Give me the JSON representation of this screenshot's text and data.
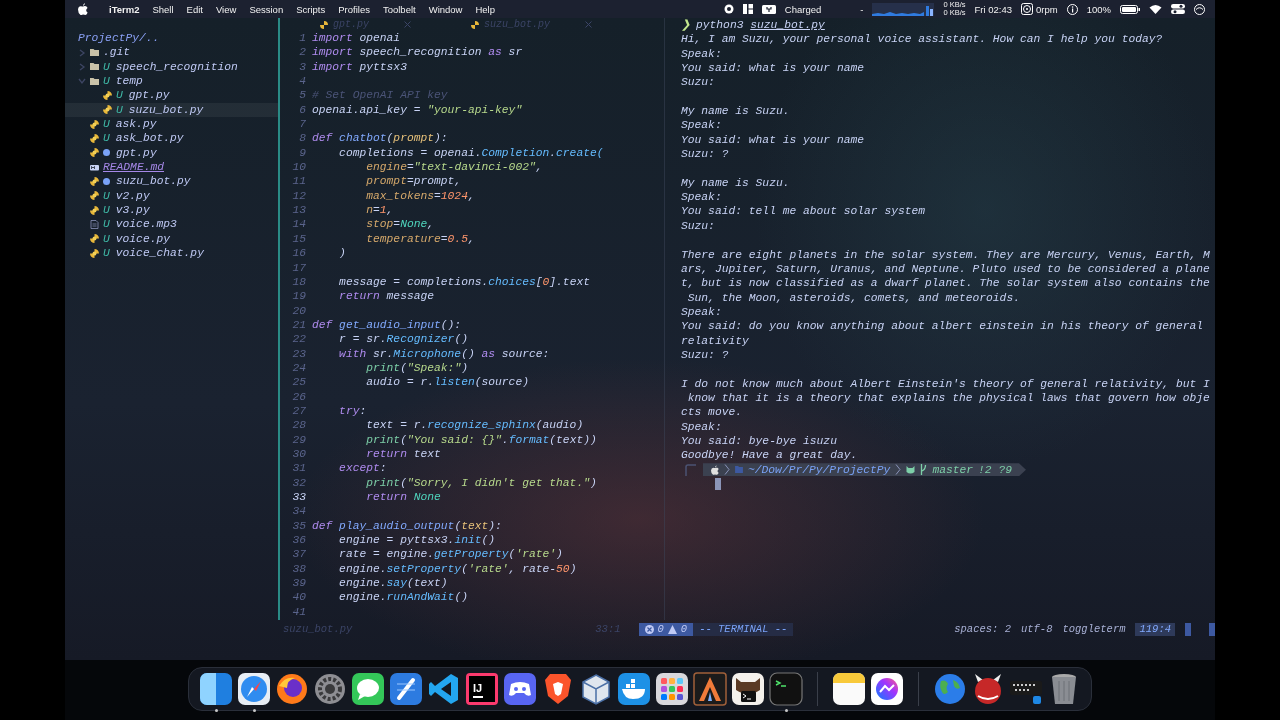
{
  "menu_bar": {
    "app": "iTerm2",
    "menus": [
      "Shell",
      "Edit",
      "View",
      "Session",
      "Scripts",
      "Profiles",
      "Toolbelt",
      "Window",
      "Help"
    ],
    "power_status": "Charged",
    "dash": "-",
    "net_up": "0 KB/s",
    "net_down": "0 KB/s",
    "clock": "Fri 02:43",
    "fan": "0rpm",
    "battery": "100%"
  },
  "sidebar": {
    "title": "ProjectPy/..",
    "items": [
      {
        "name": ".git",
        "kind": "folder",
        "expanded": false,
        "selected": false,
        "modified": false
      },
      {
        "name": "speech_recognition",
        "kind": "folder",
        "git": "U",
        "expanded": false,
        "selected": false,
        "modified": false
      },
      {
        "name": "temp",
        "kind": "folder",
        "git": "U",
        "expanded": true,
        "selected": false,
        "modified": false,
        "children": [
          {
            "name": "gpt.py",
            "kind": "python",
            "git": "U",
            "selected": false,
            "modified": false
          },
          {
            "name": "suzu_bot.py",
            "kind": "python",
            "git": "U",
            "selected": true,
            "modified": false
          }
        ]
      },
      {
        "name": "ask.py",
        "kind": "python",
        "git": "U",
        "selected": false,
        "modified": false
      },
      {
        "name": "ask_bot.py",
        "kind": "python",
        "git": "U",
        "selected": false,
        "modified": false
      },
      {
        "name": "gpt.py",
        "kind": "python",
        "selected": false,
        "modified": true
      },
      {
        "name": "README.md",
        "kind": "markdown",
        "selected": false,
        "modified": false
      },
      {
        "name": "suzu_bot.py",
        "kind": "python",
        "selected": false,
        "modified": true
      },
      {
        "name": "v2.py",
        "kind": "python",
        "git": "U",
        "selected": false,
        "modified": false
      },
      {
        "name": "v3.py",
        "kind": "python",
        "git": "U",
        "selected": false,
        "modified": false
      },
      {
        "name": "voice.mp3",
        "kind": "file",
        "git": "U",
        "selected": false,
        "modified": false
      },
      {
        "name": "voice.py",
        "kind": "python",
        "git": "U",
        "selected": false,
        "modified": false
      },
      {
        "name": "voice_chat.py",
        "kind": "python",
        "git": "U",
        "selected": false,
        "modified": false
      }
    ]
  },
  "editor": {
    "tabs": [
      {
        "label": "gpt.py",
        "selected": false
      },
      {
        "label": "suzu_bot.py",
        "selected": false
      }
    ],
    "lines": [
      {
        "number": "1",
        "current": false,
        "tokens": [
          {
            "kind": "kw",
            "text": "import"
          },
          {
            "kind": "p",
            "text": " openai"
          }
        ]
      },
      {
        "number": "2",
        "current": false,
        "tokens": [
          {
            "kind": "kw",
            "text": "import"
          },
          {
            "kind": "p",
            "text": " speech_recognition "
          },
          {
            "kind": "kw",
            "text": "as"
          },
          {
            "kind": "p",
            "text": " sr"
          }
        ]
      },
      {
        "number": "3",
        "current": false,
        "tokens": [
          {
            "kind": "kw",
            "text": "import"
          },
          {
            "kind": "p",
            "text": " pyttsx3"
          }
        ]
      },
      {
        "number": "4",
        "current": false
      },
      {
        "number": "5",
        "current": false,
        "tokens": [
          {
            "kind": "cm",
            "text": "# Set OpenAI API key"
          }
        ]
      },
      {
        "number": "6",
        "current": false,
        "tokens": [
          {
            "kind": "p",
            "text": "openai.api_key = "
          },
          {
            "kind": "str",
            "text": "\"your-api-key\""
          }
        ]
      },
      {
        "number": "7",
        "current": false
      },
      {
        "number": "8",
        "current": false,
        "tokens": [
          {
            "kind": "kw",
            "text": "def"
          },
          {
            "kind": "fn",
            "text": " chatbot"
          },
          {
            "kind": "p",
            "text": "("
          },
          {
            "kind": "param",
            "text": "prompt"
          },
          {
            "kind": "p",
            "text": "):"
          }
        ]
      },
      {
        "number": "9",
        "current": false,
        "tokens": [
          {
            "kind": "p",
            "text": "    completions = openai."
          },
          {
            "kind": "m",
            "text": "Completion"
          },
          {
            "kind": "p",
            "text": "."
          },
          {
            "kind": "m",
            "text": "create("
          }
        ]
      },
      {
        "number": "10",
        "current": false,
        "tokens": [
          {
            "kind": "arg",
            "text": "        engine"
          },
          {
            "kind": "p",
            "text": "="
          },
          {
            "kind": "str",
            "text": "\"text-davinci-002\""
          },
          {
            "kind": "p",
            "text": ","
          }
        ]
      },
      {
        "number": "11",
        "current": false,
        "tokens": [
          {
            "kind": "arg",
            "text": "        prompt"
          },
          {
            "kind": "p",
            "text": "=prompt,"
          }
        ]
      },
      {
        "number": "12",
        "current": false,
        "tokens": [
          {
            "kind": "arg",
            "text": "        max_tokens"
          },
          {
            "kind": "p",
            "text": "="
          },
          {
            "kind": "num",
            "text": "1024"
          },
          {
            "kind": "p",
            "text": ","
          }
        ]
      },
      {
        "number": "13",
        "current": false,
        "tokens": [
          {
            "kind": "arg",
            "text": "        n"
          },
          {
            "kind": "p",
            "text": "="
          },
          {
            "kind": "num",
            "text": "1"
          },
          {
            "kind": "p",
            "text": ","
          }
        ]
      },
      {
        "number": "14",
        "current": false,
        "tokens": [
          {
            "kind": "arg",
            "text": "        stop"
          },
          {
            "kind": "p",
            "text": "="
          },
          {
            "kind": "const",
            "text": "None"
          },
          {
            "kind": "p",
            "text": ","
          }
        ]
      },
      {
        "number": "15",
        "current": false,
        "tokens": [
          {
            "kind": "arg",
            "text": "        temperature"
          },
          {
            "kind": "p",
            "text": "="
          },
          {
            "kind": "num",
            "text": "0.5"
          },
          {
            "kind": "p",
            "text": ","
          }
        ]
      },
      {
        "number": "16",
        "current": false,
        "tokens": [
          {
            "kind": "p",
            "text": "    )"
          }
        ]
      },
      {
        "number": "17",
        "current": false
      },
      {
        "number": "18",
        "current": false,
        "tokens": [
          {
            "kind": "p",
            "text": "    message = completions."
          },
          {
            "kind": "m",
            "text": "choices"
          },
          {
            "kind": "p",
            "text": "["
          },
          {
            "kind": "num",
            "text": "0"
          },
          {
            "kind": "p",
            "text": "].text"
          }
        ]
      },
      {
        "number": "19",
        "current": false,
        "tokens": [
          {
            "kind": "kw",
            "text": "    return"
          },
          {
            "kind": "p",
            "text": " message"
          }
        ]
      },
      {
        "number": "20",
        "current": false
      },
      {
        "number": "21",
        "current": false,
        "tokens": [
          {
            "kind": "kw",
            "text": "def"
          },
          {
            "kind": "fn",
            "text": " get_audio_input"
          },
          {
            "kind": "p",
            "text": "():"
          }
        ]
      },
      {
        "number": "22",
        "current": false,
        "tokens": [
          {
            "kind": "p",
            "text": "    r = sr."
          },
          {
            "kind": "m",
            "text": "Recognizer"
          },
          {
            "kind": "p",
            "text": "()"
          }
        ]
      },
      {
        "number": "23",
        "current": false,
        "tokens": [
          {
            "kind": "kw",
            "text": "    with"
          },
          {
            "kind": "p",
            "text": " sr."
          },
          {
            "kind": "m",
            "text": "Microphone"
          },
          {
            "kind": "p",
            "text": "() "
          },
          {
            "kind": "kw",
            "text": "as"
          },
          {
            "kind": "p",
            "text": " source:"
          }
        ]
      },
      {
        "number": "24",
        "current": false,
        "tokens": [
          {
            "kind": "bi",
            "text": "        print"
          },
          {
            "kind": "p",
            "text": "("
          },
          {
            "kind": "str",
            "text": "\"Speak:\""
          },
          {
            "kind": "p",
            "text": ")"
          }
        ]
      },
      {
        "number": "25",
        "current": false,
        "tokens": [
          {
            "kind": "p",
            "text": "        audio = r."
          },
          {
            "kind": "m",
            "text": "listen"
          },
          {
            "kind": "p",
            "text": "(source)"
          }
        ]
      },
      {
        "number": "26",
        "current": false
      },
      {
        "number": "27",
        "current": false,
        "tokens": [
          {
            "kind": "kw",
            "text": "    try"
          },
          {
            "kind": "p",
            "text": ":"
          }
        ]
      },
      {
        "number": "28",
        "current": false,
        "tokens": [
          {
            "kind": "p",
            "text": "        text = r."
          },
          {
            "kind": "m",
            "text": "recognize_sphinx"
          },
          {
            "kind": "p",
            "text": "(audio)"
          }
        ]
      },
      {
        "number": "29",
        "current": false,
        "tokens": [
          {
            "kind": "bi",
            "text": "        print"
          },
          {
            "kind": "p",
            "text": "("
          },
          {
            "kind": "str",
            "text": "\"You said: {}\""
          },
          {
            "kind": "p",
            "text": "."
          },
          {
            "kind": "m",
            "text": "format"
          },
          {
            "kind": "p",
            "text": "(text))"
          }
        ]
      },
      {
        "number": "30",
        "current": false,
        "tokens": [
          {
            "kind": "kw",
            "text": "        return"
          },
          {
            "kind": "p",
            "text": " text"
          }
        ]
      },
      {
        "number": "31",
        "current": false,
        "tokens": [
          {
            "kind": "kw",
            "text": "    except"
          },
          {
            "kind": "p",
            "text": ":"
          }
        ]
      },
      {
        "number": "32",
        "current": false,
        "tokens": [
          {
            "kind": "bi",
            "text": "        print"
          },
          {
            "kind": "p",
            "text": "("
          },
          {
            "kind": "str",
            "text": "\"Sorry, I didn't get that.\""
          },
          {
            "kind": "p",
            "text": ")"
          }
        ]
      },
      {
        "number": "33",
        "current": true,
        "tokens": [
          {
            "kind": "kw",
            "text": "        return"
          },
          {
            "kind": "const",
            "text": " None"
          }
        ]
      },
      {
        "number": "34",
        "current": false
      },
      {
        "number": "35",
        "current": false,
        "tokens": [
          {
            "kind": "kw",
            "text": "def"
          },
          {
            "kind": "fn",
            "text": " play_audio_output"
          },
          {
            "kind": "p",
            "text": "("
          },
          {
            "kind": "param",
            "text": "text"
          },
          {
            "kind": "p",
            "text": "):"
          }
        ]
      },
      {
        "number": "36",
        "current": false,
        "tokens": [
          {
            "kind": "p",
            "text": "    engine = pyttsx3."
          },
          {
            "kind": "m",
            "text": "init"
          },
          {
            "kind": "p",
            "text": "()"
          }
        ]
      },
      {
        "number": "37",
        "current": false,
        "tokens": [
          {
            "kind": "p",
            "text": "    rate = engine."
          },
          {
            "kind": "m",
            "text": "getProperty"
          },
          {
            "kind": "p",
            "text": "("
          },
          {
            "kind": "str",
            "text": "'rate'"
          },
          {
            "kind": "p",
            "text": ")"
          }
        ]
      },
      {
        "number": "38",
        "current": false,
        "tokens": [
          {
            "kind": "p",
            "text": "    engine."
          },
          {
            "kind": "m",
            "text": "setProperty"
          },
          {
            "kind": "p",
            "text": "("
          },
          {
            "kind": "str",
            "text": "'rate'"
          },
          {
            "kind": "p",
            "text": ", rate-"
          },
          {
            "kind": "num",
            "text": "50"
          },
          {
            "kind": "p",
            "text": ")"
          }
        ]
      },
      {
        "number": "39",
        "current": false,
        "tokens": [
          {
            "kind": "p",
            "text": "    engine."
          },
          {
            "kind": "m",
            "text": "say"
          },
          {
            "kind": "p",
            "text": "(text)"
          }
        ]
      },
      {
        "number": "40",
        "current": false,
        "tokens": [
          {
            "kind": "p",
            "text": "    engine."
          },
          {
            "kind": "m",
            "text": "runAndWait"
          },
          {
            "kind": "p",
            "text": "()"
          }
        ]
      },
      {
        "number": "41",
        "current": false
      }
    ]
  },
  "terminal": {
    "prompt_symbol": "❯",
    "command": "python3",
    "argument": "suzu_bot.py",
    "blocks": [
      [
        "Hi, I am Suzu, your personal voice assistant. How can I help you today?",
        "Speak:",
        "You said: what is your name",
        "Suzu:"
      ],
      [
        "My name is Suzu.",
        "Speak:",
        "You said: what is your name",
        "Suzu: ?"
      ],
      [
        "My name is Suzu.",
        "Speak:",
        "You said: tell me about solar system",
        "Suzu:"
      ],
      [
        "There are eight planets in the solar system. They are Mercury, Venus, Earth, M",
        "ars, Jupiter, Saturn, Uranus, and Neptune. Pluto used to be considered a plane",
        "t, but is now classified as a dwarf planet. The solar system also contains the",
        " Sun, the Moon, asteroids, comets, and meteoroids.",
        "Speak:",
        "You said: do you know anything about albert einstein in his theory of general",
        "relativity",
        "Suzu: ?"
      ],
      [
        "I do not know much about Albert Einstein's theory of general relativity, but I",
        " know that it is a theory that explains the physical laws that govern how obje",
        "cts move.",
        "Speak:",
        "You said: bye-bye isuzu",
        "Goodbye! Have a great day."
      ]
    ],
    "path": "~/Dow/Pr/Py/ProjectPy",
    "branch": "master",
    "git_status": "!2 ?9"
  },
  "status_bar": {
    "file": "suzu_bot.py",
    "position": "33:1",
    "errors": "0",
    "warnings": "0",
    "mode": "-- TERMINAL --",
    "indent": "spaces: 2",
    "encoding": "utf-8",
    "filetype": "toggleterm",
    "cursor": "119:4"
  },
  "dock": {
    "sections": [
      {
        "apps": [
          {
            "kind": "split-square",
            "running": true
          },
          {
            "kind": "compass",
            "running": true
          },
          {
            "kind": "swirl",
            "running": false
          },
          {
            "kind": "gear",
            "running": false
          },
          {
            "kind": "chat",
            "running": false
          },
          {
            "kind": "pencil",
            "running": false
          },
          {
            "kind": "ribbon",
            "running": false
          },
          {
            "kind": "letter-tile",
            "label": "IJ",
            "running": false
          },
          {
            "kind": "gamepad",
            "running": false
          },
          {
            "kind": "shield",
            "running": false
          },
          {
            "kind": "cube",
            "running": false
          },
          {
            "kind": "whale",
            "running": false
          },
          {
            "kind": "app-grid",
            "running": false
          },
          {
            "kind": "triangle",
            "running": false
          },
          {
            "kind": "terminal-light",
            "running": false
          },
          {
            "kind": "terminal-dark",
            "running": true
          }
        ]
      },
      {
        "apps": [
          {
            "kind": "notepad",
            "running": false
          },
          {
            "kind": "messenger",
            "running": false
          }
        ]
      },
      {
        "apps": [
          {
            "kind": "globe",
            "running": false
          },
          {
            "kind": "horned",
            "running": false
          },
          {
            "kind": "keyboard",
            "running": false
          },
          {
            "kind": "trash",
            "running": false
          }
        ]
      }
    ]
  }
}
